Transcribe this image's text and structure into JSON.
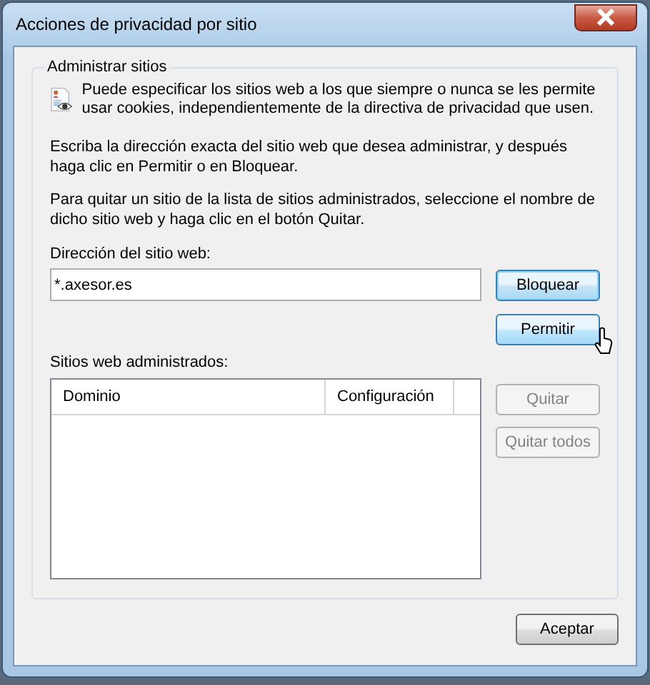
{
  "window": {
    "title": "Acciones de privacidad por sitio"
  },
  "group": {
    "title": "Administrar sitios",
    "intro": "Puede especificar los sitios web a los que siempre o nunca se les permite usar cookies, independientemente de la directiva de privacidad que usen.",
    "paragraphs": [
      "Escriba la dirección exacta del sitio web que desea administrar, y después haga clic en Permitir o en Bloquear.",
      "Para quitar un sitio de la lista de sitios administrados, seleccione el nombre de dicho sitio web y haga clic en el botón Quitar."
    ],
    "address": {
      "label": "Dirección del sitio web:",
      "value": "*.axesor.es"
    },
    "top_buttons": [
      {
        "label": "Bloquear",
        "default": true,
        "hovered": false,
        "disabled": false
      },
      {
        "label": "Permitir",
        "default": false,
        "hovered": true,
        "disabled": false
      }
    ],
    "list": {
      "label": "Sitios web administrados:",
      "columns": [
        "Dominio",
        "Configuración"
      ]
    },
    "list_buttons": [
      {
        "label": "Quitar",
        "default": false,
        "hovered": false,
        "disabled": true
      },
      {
        "label": "Quitar todos",
        "default": false,
        "hovered": false,
        "disabled": true
      }
    ]
  },
  "buttons": [
    {
      "label": "Aceptar",
      "default": false,
      "hovered": false,
      "disabled": false
    }
  ]
}
